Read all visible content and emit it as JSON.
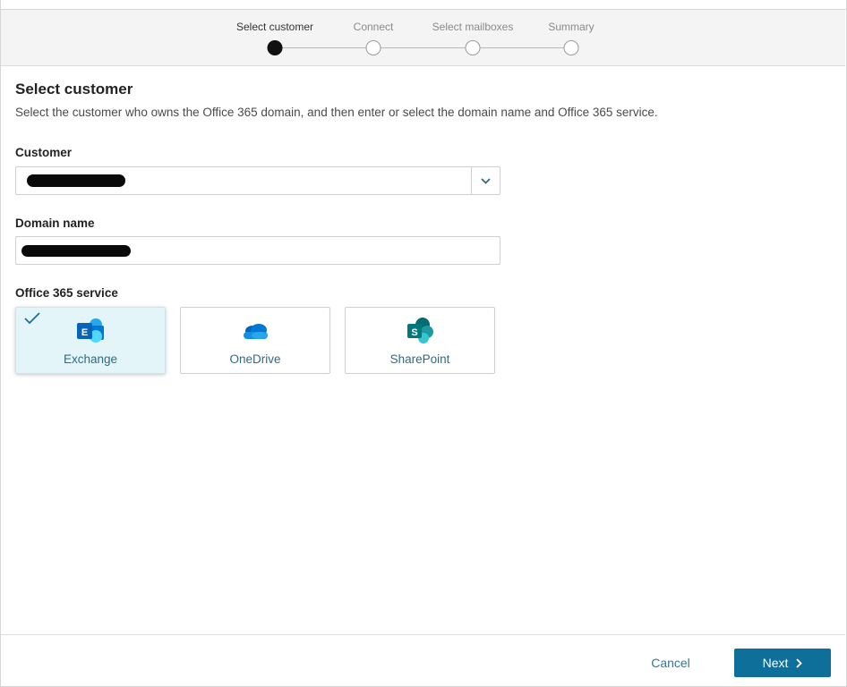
{
  "stepper": {
    "steps": [
      {
        "label": "Select customer",
        "state": "active"
      },
      {
        "label": "Connect",
        "state": "pending"
      },
      {
        "label": "Select mailboxes",
        "state": "pending"
      },
      {
        "label": "Summary",
        "state": "pending"
      }
    ]
  },
  "page": {
    "title": "Select customer",
    "description": "Select the customer who owns the Office 365 domain, and then enter or select the domain name and Office 365 service."
  },
  "customer": {
    "label": "Customer",
    "value_redacted": true,
    "chevron_icon": "chevron-down-icon"
  },
  "domain": {
    "label": "Domain name",
    "value_redacted": true
  },
  "service": {
    "label": "Office 365 service",
    "options": [
      {
        "label": "Exchange",
        "icon": "exchange-icon",
        "selected": true
      },
      {
        "label": "OneDrive",
        "icon": "onedrive-icon",
        "selected": false
      },
      {
        "label": "SharePoint",
        "icon": "sharepoint-icon",
        "selected": false
      }
    ]
  },
  "footer": {
    "cancel_label": "Cancel",
    "next_label": "Next",
    "next_icon": "chevron-right-icon"
  },
  "colors": {
    "primary": "#0f6f9b",
    "link": "#2d7a98",
    "selected_tile_bg": "#e4f5f9"
  }
}
